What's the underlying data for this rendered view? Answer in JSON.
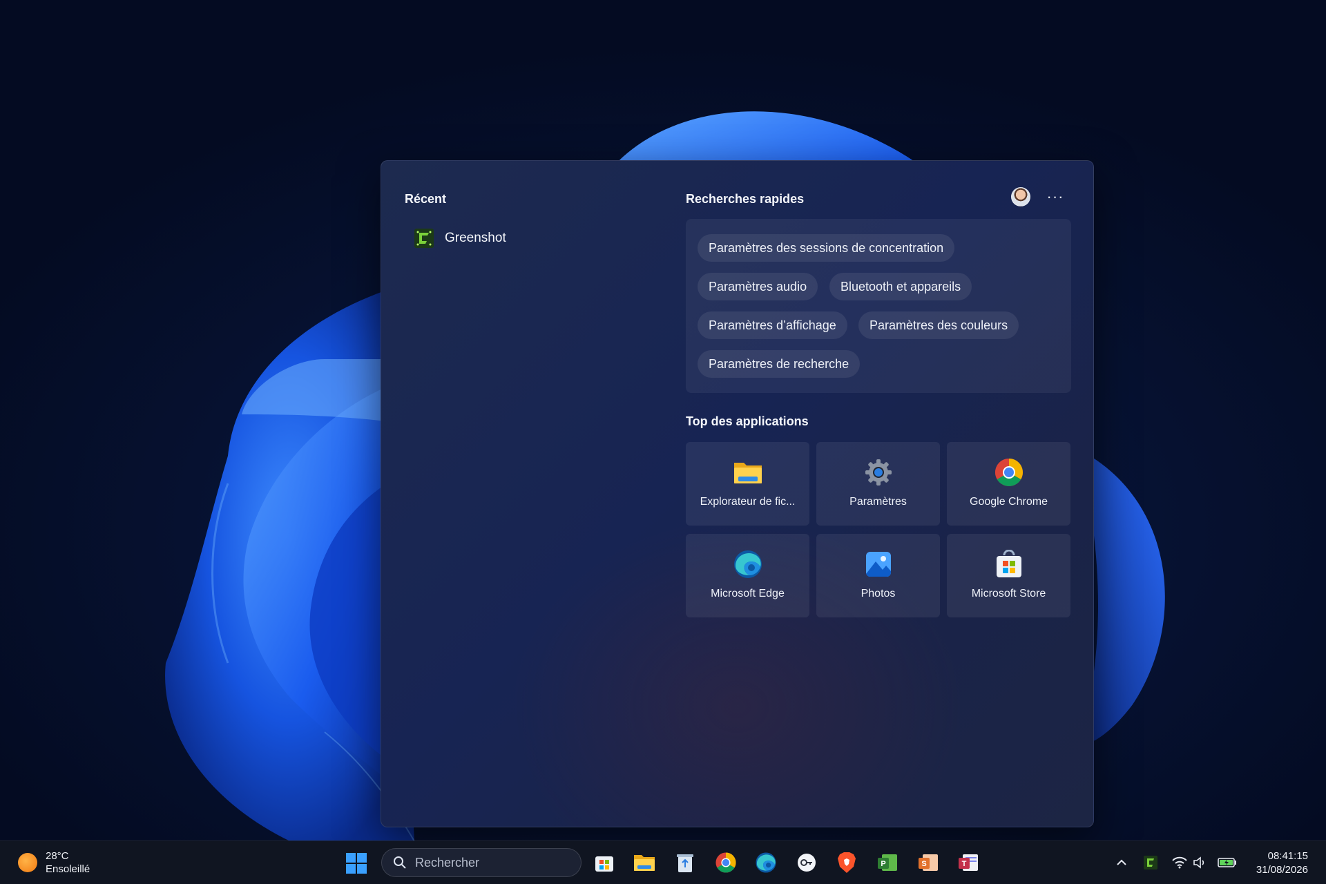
{
  "recent": {
    "title": "Récent",
    "items": [
      {
        "label": "Greenshot",
        "icon": "greenshot-icon"
      }
    ]
  },
  "quick_searches": {
    "title": "Recherches rapides",
    "chips": [
      "Paramètres des sessions de concentration",
      "Paramètres audio",
      "Bluetooth et appareils",
      "Paramètres d’affichage",
      "Paramètres des couleurs",
      "Paramètres de recherche"
    ]
  },
  "more_label": "···",
  "top_apps": {
    "title": "Top des applications",
    "apps": [
      {
        "label": "Explorateur de fic...",
        "icon": "file-explorer-icon"
      },
      {
        "label": "Paramètres",
        "icon": "settings-gear-icon"
      },
      {
        "label": "Google Chrome",
        "icon": "chrome-icon"
      },
      {
        "label": "Microsoft Edge",
        "icon": "edge-icon"
      },
      {
        "label": "Photos",
        "icon": "photos-icon"
      },
      {
        "label": "Microsoft Store",
        "icon": "store-icon"
      }
    ]
  },
  "taskbar": {
    "weather_temp": "28°C",
    "weather_desc": "Ensoleillé",
    "search_placeholder": "Rechercher",
    "pinned_icons": [
      "microsoft-store-icon",
      "file-explorer-icon",
      "recycle-bin-icon",
      "chrome-icon",
      "edge-icon",
      "key-app-icon",
      "brave-icon",
      "project-app-icon",
      "sway-app-icon",
      "teams-app-icon"
    ],
    "tray_icons": [
      "chevron-up-icon",
      "greenshot-icon",
      "wifi-icon",
      "volume-icon",
      "battery-icon"
    ],
    "time": "08:41:15",
    "date": "31/08/2026"
  },
  "colors": {
    "accent_blue": "#1e6bff",
    "panel_bg": "#1b2650",
    "taskbar_bg": "#101521"
  }
}
